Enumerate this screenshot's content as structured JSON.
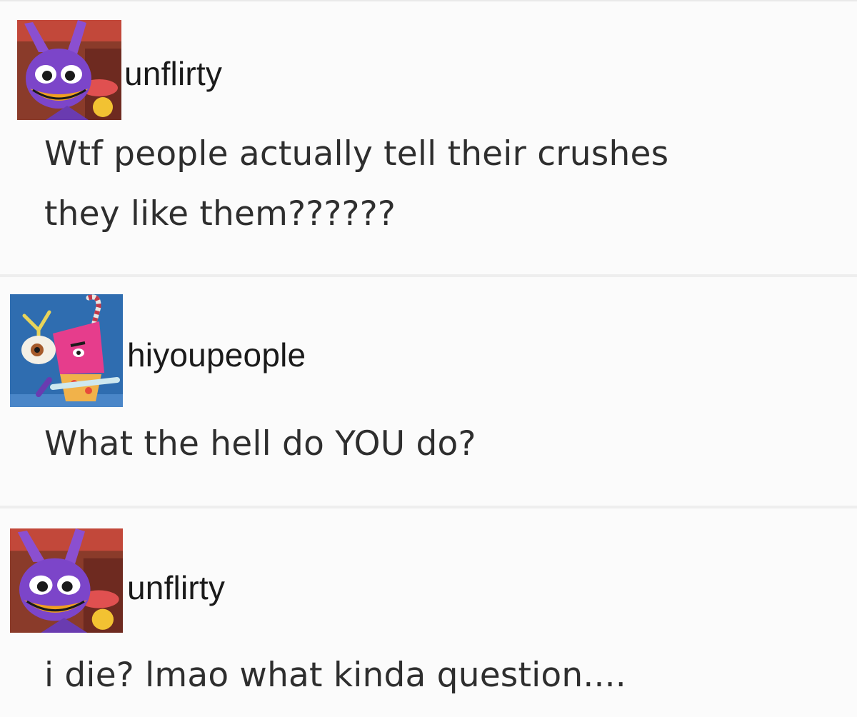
{
  "posts": [
    {
      "avatar_icon": "jester-character-avatar-icon",
      "username": "unflirty",
      "message_lines": [
        "Wtf people actually tell their crushes",
        "they like them??????"
      ]
    },
    {
      "avatar_icon": "pink-cyclops-character-avatar-icon",
      "username": "hiyoupeople",
      "message_lines": [
        "What the hell do YOU do?"
      ]
    },
    {
      "avatar_icon": "jester-character-avatar-icon",
      "username": "unflirty",
      "message_lines": [
        "i die? lmao what kinda question...."
      ]
    }
  ],
  "colors": {
    "background": "#fbfbfb",
    "text": "#2e2e2e",
    "username": "#1a1a1a",
    "divider": "#eeeeee"
  }
}
